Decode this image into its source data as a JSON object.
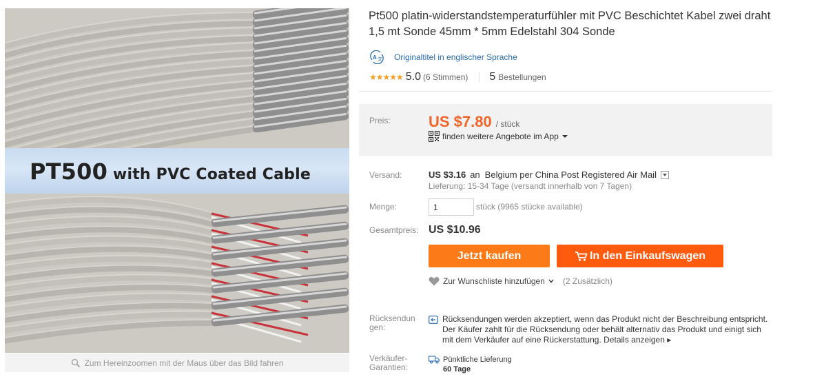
{
  "product": {
    "title": "Pt500 platin-widerstandstemperaturfühler mit PVC Beschichtet Kabel zwei draht 1,5 mt Sonde 45mm * 5mm Edelstahl 304 Sonde",
    "original_title_link": "Originaltitel in englischer Sprache",
    "rating": {
      "stars": "★★★★★",
      "value": "5.0",
      "votes": "(6 Stimmen)"
    },
    "orders": {
      "count": "5",
      "label": "Bestellungen"
    }
  },
  "image": {
    "banner_big": "PT500",
    "banner_small": " with PVC Coated Cable",
    "zoom_hint": "Zum Hereinzoomen mit der Maus über das Bild fahren"
  },
  "price": {
    "label": "Preis:",
    "value": "US $7.80",
    "unit": "/ stück",
    "app_offer": "finden weitere Angebote im App"
  },
  "shipping": {
    "label": "Versand:",
    "cost": "US $3.16",
    "to": "an",
    "destination": "Belgium per China Post Registered Air Mail",
    "delivery": "Lieferung: 15-34 Tage (versandt innerhalb von 7 Tagen)"
  },
  "quantity": {
    "label": "Menge:",
    "value": "1",
    "note": "stück (9965 stücke available)"
  },
  "total": {
    "label": "Gesamtpreis:",
    "value": "US $10.96"
  },
  "actions": {
    "buy_now": "Jetzt kaufen",
    "add_to_cart": "In den Einkaufswagen",
    "wishlist": "Zur Wunschliste hinzufügen",
    "wishlist_count": "(2 Zusätzlich)"
  },
  "returns": {
    "label_line1": "Rücksendun",
    "label_line2": "gen:",
    "text": "Rücksendungen werden akzeptiert, wenn das Produkt nicht der Beschreibung entspricht. Der Käufer zahlt für die Rücksendung oder behält alternativ das Produkt und einigt sich mit dem Verkäufer auf eine Rückerstattung.",
    "more": "Details anzeigen"
  },
  "guarantee": {
    "label_line1": "Verkäufer-",
    "label_line2": "Garantien:",
    "text": "Pünktliche Lieferung",
    "days": "60 Tage"
  },
  "colors": {
    "price": "#f0652a",
    "buy_button": "#fc7b18",
    "cart_button": "#ff5b0f",
    "link": "#2a6cb0",
    "star": "#f59a1b"
  }
}
